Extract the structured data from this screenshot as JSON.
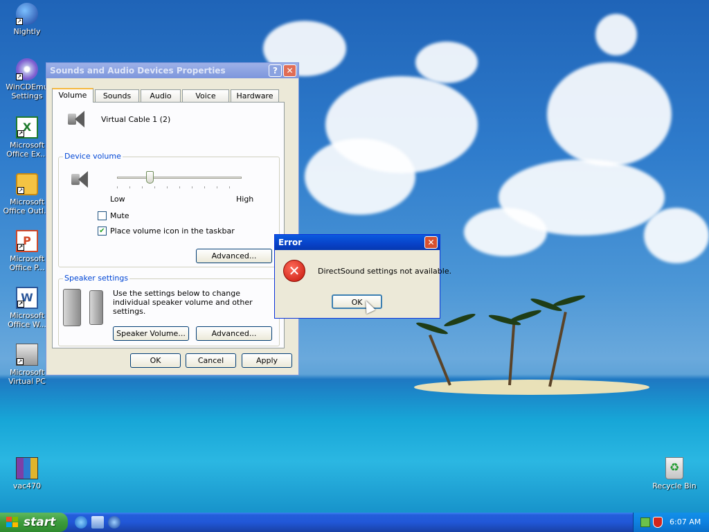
{
  "desktop_icons": [
    {
      "label": "Nightly",
      "icon": "nightly-globe-icon"
    },
    {
      "label": "WinCDEmu Settings",
      "icon": "wincdemu-disc-icon"
    },
    {
      "label": "Microsoft Office Ex...",
      "icon": "excel-icon"
    },
    {
      "label": "Microsoft Office Outl...",
      "icon": "outlook-icon"
    },
    {
      "label": "Microsoft Office P...",
      "icon": "powerpoint-icon"
    },
    {
      "label": "Microsoft Office W...",
      "icon": "word-icon"
    },
    {
      "label": "Microsoft Virtual PC",
      "icon": "virtual-pc-icon"
    },
    {
      "label": "vac470",
      "icon": "winrar-archive-icon"
    },
    {
      "label": "Recycle Bin",
      "icon": "recycle-bin-icon"
    }
  ],
  "properties_dialog": {
    "title": "Sounds and Audio Devices Properties",
    "help_button": "?",
    "close_button": "✕",
    "tabs": [
      "Volume",
      "Sounds",
      "Audio",
      "Voice",
      "Hardware"
    ],
    "selected_tab": "Volume",
    "device_name": "Virtual Cable 1 (2)",
    "device_volume": {
      "legend": "Device volume",
      "low_label": "Low",
      "high_label": "High",
      "slider_level": 0.25,
      "mute_label": "Mute",
      "mute_checked": false,
      "taskbar_icon_label": "Place volume icon in the taskbar",
      "taskbar_icon_checked": true,
      "advanced_button": "Advanced..."
    },
    "speaker_settings": {
      "legend": "Speaker settings",
      "description": "Use the settings below to change individual speaker volume and other settings.",
      "speaker_volume_button": "Speaker Volume...",
      "advanced_button": "Advanced..."
    },
    "ok_button": "OK",
    "cancel_button": "Cancel",
    "apply_button": "Apply"
  },
  "error_dialog": {
    "title": "Error",
    "close_button": "✕",
    "message": "DirectSound settings not available.",
    "ok_button": "OK",
    "icon": "error-x-icon"
  },
  "taskbar": {
    "start_label": "start",
    "quick_launch": [
      "ie-icon",
      "show-desktop-icon",
      "media-player-icon"
    ],
    "tray_icons": [
      "network-icon",
      "security-shield-icon"
    ],
    "clock": "6:07 AM"
  }
}
